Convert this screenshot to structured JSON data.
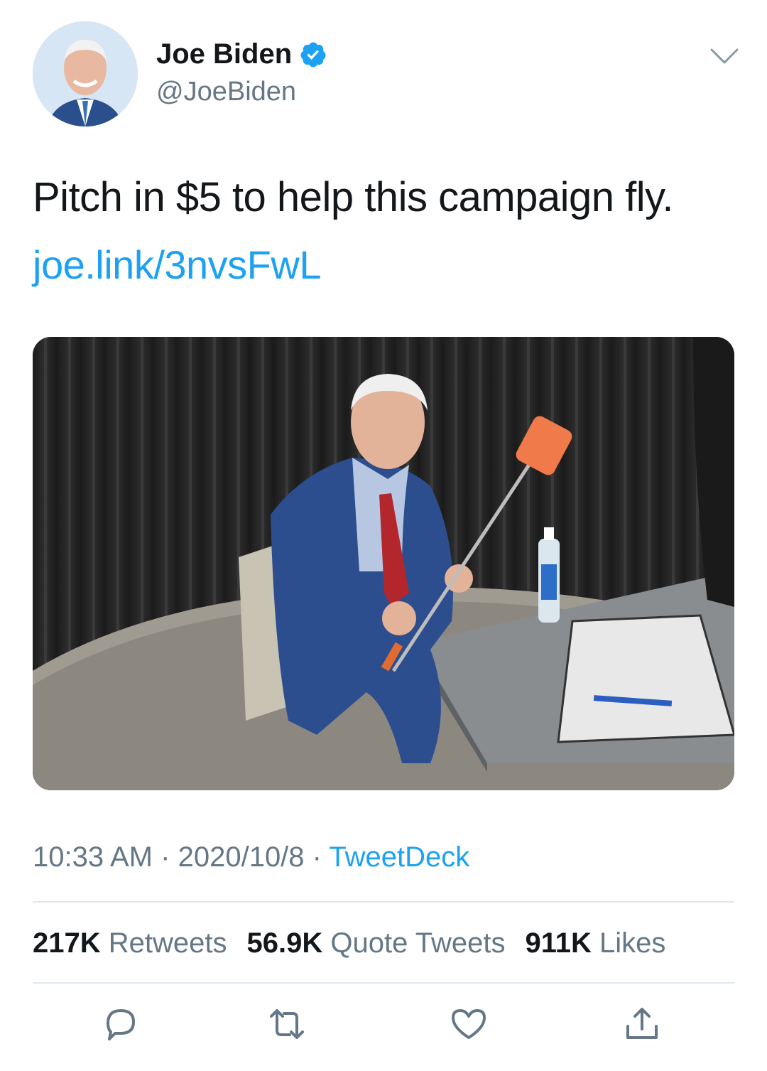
{
  "author": {
    "name": "Joe Biden",
    "handle": "@JoeBiden",
    "verified": true
  },
  "tweet": {
    "text": "Pitch in $5 to help this campaign fly.",
    "link": "joe.link/3nvsFwL"
  },
  "meta": {
    "time": "10:33 AM",
    "separator": "·",
    "date": "2020/10/8",
    "source": "TweetDeck"
  },
  "stats": {
    "retweets_count": "217K",
    "retweets_label": "Retweets",
    "quotes_count": "56.9K",
    "quotes_label": "Quote Tweets",
    "likes_count": "911K",
    "likes_label": "Likes"
  },
  "actions": [
    "reply-icon",
    "retweet-icon",
    "like-icon",
    "share-icon"
  ],
  "colors": {
    "accent": "#1da1f2",
    "text": "#14171a",
    "muted": "#657786",
    "divider": "#e1e8ed"
  }
}
